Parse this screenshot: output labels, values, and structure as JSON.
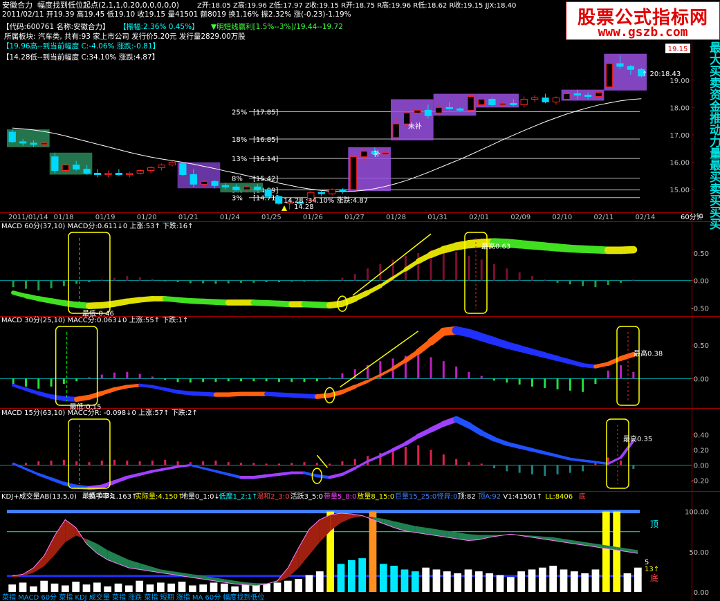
{
  "header": {
    "line1_name": "安徽合力",
    "line1_formula": "幅度找到低位起点(2,1,1,0,20,0,0,0,0,0)",
    "line1_stats": "Z开:18.05 Z高:19.96 Z低:17.97 Z收:19.15 R开:18.75 R高:19.96 R低:18.62 R收:19.15 JJX:18.40",
    "line2": "2011/02/11 开19.39 高19.45 低19.10 收19.15 量41501 额8019 换1.16% 振2.32% 涨(-0.23)-1.19%",
    "info_code": "【代码:600761 名称:安徽合力】",
    "info_amp": "【振幅:2.36% 0.45%】",
    "info_profit": "▼明短线赢利[1.5%--3%]/19.44--19.72",
    "info_sector": "所属板块: 汽车类, 共有:93 家上市公司  发行价5.20元  发行量2829.00万股",
    "info_high": "【19.96高--到当前幅度 C:-4.06%  涨跌:-0.81】",
    "info_low": "【14.28低--到当前幅度 C:34.10%  涨跌:4.87】"
  },
  "brand": {
    "title": "股票公式指标网",
    "url": "www.gszb.com"
  },
  "side_text": "最大买卖资金推动力量最买卖买买买",
  "dates": [
    "2011/01/14",
    "01/18",
    "01/19",
    "01/20",
    "01/21",
    "01/24",
    "01/25",
    "01/26",
    "01/27",
    "01/28",
    "01/31",
    "02/01",
    "02/09",
    "02/10",
    "02/11",
    "02/14"
  ],
  "period_label": "60分钟",
  "colors": {
    "up": "#ff2020",
    "down": "#00d8ff",
    "ma": "#ffffff",
    "grid": "#a00000",
    "level": "#c0c0c0"
  },
  "chart_data": [
    {
      "type": "candlestick",
      "name_label": "price",
      "y_ticks": [
        "19.00",
        "18.00",
        "17.00",
        "16.00",
        "15.00"
      ],
      "y_values": [
        19.0,
        18.0,
        17.0,
        16.0,
        15.0
      ],
      "ylim": [
        14.35,
        19.6
      ],
      "levels": [
        {
          "label": "25%",
          "price_label": "[17.85]",
          "value": 17.85
        },
        {
          "label": "18%",
          "price_label": "[16.85]",
          "value": 16.85
        },
        {
          "label": "13%",
          "price_label": "[16.14]",
          "value": 16.14
        },
        {
          "label": "8%",
          "price_label": "[15.42]",
          "value": 15.42
        },
        {
          "label": "5%",
          "price_label": "[14.99]",
          "value": 14.99
        },
        {
          "label": "3%",
          "price_label": "[14.71]",
          "value": 14.71
        }
      ],
      "ohlc": [
        [
          17.1,
          17.2,
          16.7,
          16.75
        ],
        [
          16.75,
          16.85,
          16.6,
          16.7
        ],
        [
          16.7,
          16.8,
          16.55,
          16.65
        ],
        [
          16.65,
          16.75,
          16.55,
          16.7
        ],
        [
          16.2,
          16.35,
          15.6,
          15.7
        ],
        [
          15.7,
          16.0,
          15.55,
          15.9
        ],
        [
          15.9,
          16.05,
          15.7,
          15.75
        ],
        [
          15.75,
          15.9,
          15.55,
          15.6
        ],
        [
          15.6,
          15.75,
          15.45,
          15.55
        ],
        [
          15.55,
          15.7,
          15.45,
          15.6
        ],
        [
          15.6,
          15.75,
          15.5,
          15.55
        ],
        [
          15.55,
          15.65,
          15.45,
          15.6
        ],
        [
          15.6,
          15.75,
          15.55,
          15.7
        ],
        [
          15.7,
          15.85,
          15.6,
          15.8
        ],
        [
          15.8,
          15.95,
          15.7,
          15.9
        ],
        [
          15.9,
          16.05,
          15.85,
          16.0
        ],
        [
          15.95,
          16.0,
          15.5,
          15.55
        ],
        [
          15.55,
          15.75,
          15.1,
          15.2
        ],
        [
          15.2,
          15.35,
          15.1,
          15.3
        ],
        [
          15.3,
          15.35,
          15.05,
          15.15
        ],
        [
          15.15,
          15.25,
          15.0,
          15.1
        ],
        [
          15.1,
          15.2,
          14.95,
          15.0
        ],
        [
          15.0,
          15.15,
          14.9,
          15.1
        ],
        [
          15.1,
          15.2,
          14.95,
          15.0
        ],
        [
          15.0,
          15.05,
          14.7,
          14.75
        ],
        [
          14.75,
          14.8,
          14.45,
          14.5
        ],
        [
          14.5,
          14.65,
          14.28,
          14.55
        ],
        [
          14.55,
          14.65,
          14.4,
          14.5
        ],
        [
          14.6,
          14.95,
          14.55,
          14.9
        ],
        [
          14.9,
          15.0,
          14.75,
          14.85
        ],
        [
          14.85,
          15.05,
          14.8,
          15.0
        ],
        [
          15.0,
          15.05,
          14.85,
          14.95
        ],
        [
          15.0,
          16.3,
          14.95,
          16.2
        ],
        [
          16.2,
          16.5,
          16.05,
          16.4
        ],
        [
          16.4,
          16.55,
          16.2,
          16.3
        ],
        [
          16.3,
          16.45,
          16.15,
          16.35
        ],
        [
          16.9,
          17.6,
          16.8,
          17.4
        ],
        [
          17.4,
          17.85,
          17.3,
          17.8
        ],
        [
          17.8,
          18.3,
          17.6,
          17.9
        ],
        [
          17.9,
          18.1,
          17.6,
          17.7
        ],
        [
          17.8,
          18.1,
          17.7,
          18.0
        ],
        [
          18.0,
          18.2,
          17.9,
          17.95
        ],
        [
          17.95,
          18.0,
          17.85,
          17.9
        ],
        [
          17.9,
          18.5,
          17.85,
          18.4
        ],
        [
          18.1,
          18.5,
          18.0,
          18.3
        ],
        [
          18.3,
          18.35,
          18.05,
          18.1
        ],
        [
          18.1,
          18.2,
          18.0,
          18.15
        ],
        [
          18.15,
          18.3,
          18.05,
          18.1
        ],
        [
          18.1,
          18.4,
          18.0,
          18.3
        ],
        [
          18.3,
          18.45,
          18.2,
          18.35
        ],
        [
          18.35,
          18.5,
          18.15,
          18.2
        ],
        [
          18.2,
          18.4,
          18.1,
          18.35
        ],
        [
          18.3,
          18.6,
          18.25,
          18.5
        ],
        [
          18.5,
          18.65,
          18.3,
          18.45
        ],
        [
          18.45,
          18.55,
          18.3,
          18.4
        ],
        [
          18.4,
          18.6,
          18.35,
          18.55
        ],
        [
          18.75,
          19.96,
          18.62,
          19.6
        ],
        [
          19.6,
          19.9,
          19.4,
          19.5
        ],
        [
          19.5,
          19.55,
          19.2,
          19.39
        ],
        [
          19.39,
          19.45,
          19.1,
          19.15
        ]
      ],
      "ma": [
        17.25,
        17.22,
        17.18,
        17.12,
        17.05,
        16.96,
        16.86,
        16.76,
        16.66,
        16.56,
        16.46,
        16.36,
        16.27,
        16.19,
        16.12,
        16.06,
        16.0,
        15.93,
        15.85,
        15.77,
        15.68,
        15.6,
        15.51,
        15.42,
        15.33,
        15.24,
        15.16,
        15.08,
        15.02,
        14.97,
        14.94,
        14.93,
        14.94,
        14.98,
        15.04,
        15.12,
        15.22,
        15.34,
        15.48,
        15.63,
        15.79,
        15.95,
        16.11,
        16.28,
        16.46,
        16.64,
        16.82,
        16.99,
        17.16,
        17.32,
        17.48,
        17.62,
        17.76,
        17.88,
        17.99,
        18.09,
        18.17,
        18.24,
        18.29,
        18.32
      ],
      "annotations": {
        "price_now": "19.15",
        "ma_value": "↑ 20:18.43",
        "low_label": "14.28",
        "low_stats": "14.28 :34.10%  涨跌:4.87",
        "high_label": "19.96",
        "supplement": "补",
        "supplement2": "未补",
        "supplement3": "补"
      }
    },
    {
      "type": "macd",
      "title": "MACD 60分(37,10)  MACD分:0.611↓0  上涨:53↑ 下跌:16↑",
      "y_ticks": [
        "0.50",
        "0.00",
        "-0.50"
      ],
      "y_values": [
        0.5,
        0.0,
        -0.5
      ],
      "ylim": [
        -0.62,
        0.9
      ],
      "values": [
        -0.22,
        -0.28,
        -0.33,
        -0.37,
        -0.41,
        -0.44,
        -0.46,
        -0.45,
        -0.42,
        -0.38,
        -0.35,
        -0.33,
        -0.33,
        -0.35,
        -0.37,
        -0.38,
        -0.39,
        -0.4,
        -0.4,
        -0.4,
        -0.41,
        -0.42,
        -0.43,
        -0.43,
        -0.44,
        -0.45,
        -0.42,
        -0.33,
        -0.22,
        -0.1,
        0.05,
        0.2,
        0.35,
        0.47,
        0.56,
        0.62,
        0.66,
        0.68,
        0.69,
        0.68,
        0.66,
        0.64,
        0.62,
        0.6,
        0.58,
        0.57,
        0.56,
        0.55,
        0.55,
        0.56
      ],
      "hist": [
        -0.12,
        -0.15,
        -0.18,
        -0.14,
        -0.1,
        -0.06,
        -0.03,
        0.02,
        0.05,
        0.08,
        0.06,
        0.03,
        -0.01,
        -0.03,
        -0.05,
        -0.05,
        -0.06,
        -0.05,
        -0.04,
        -0.04,
        -0.03,
        -0.03,
        -0.02,
        -0.02,
        -0.01,
        0.0,
        0.05,
        0.12,
        0.22,
        0.3,
        0.38,
        0.45,
        0.5,
        0.55,
        0.58,
        0.52,
        0.45,
        0.38,
        0.3,
        0.22,
        0.15,
        0.08,
        0.02,
        -0.04,
        -0.07,
        -0.1,
        -0.12,
        -0.08,
        -0.04,
        0.02
      ],
      "mark_low": "最低-0.46",
      "mark_high": "最高0.63"
    },
    {
      "type": "macd",
      "title": "MACD 30分(25,10)  MACC分:0.063↓0  上涨:55↑ 下跌:1↑",
      "y_ticks": [
        "0.50",
        "0.00"
      ],
      "y_values": [
        0.5,
        0.0
      ],
      "ylim": [
        -0.42,
        0.8
      ],
      "values": [
        -0.1,
        -0.16,
        -0.22,
        -0.27,
        -0.3,
        -0.31,
        -0.28,
        -0.22,
        -0.16,
        -0.12,
        -0.1,
        -0.12,
        -0.16,
        -0.2,
        -0.22,
        -0.23,
        -0.24,
        -0.24,
        -0.23,
        -0.23,
        -0.23,
        -0.24,
        -0.25,
        -0.26,
        -0.27,
        -0.25,
        -0.2,
        -0.12,
        -0.04,
        0.05,
        0.15,
        0.27,
        0.4,
        0.55,
        0.7,
        0.72,
        0.68,
        0.62,
        0.56,
        0.5,
        0.45,
        0.4,
        0.35,
        0.3,
        0.25,
        0.2,
        0.18,
        0.22,
        0.3,
        0.36
      ],
      "hist": [
        -0.1,
        -0.12,
        -0.15,
        -0.12,
        -0.08,
        -0.04,
        0.02,
        0.06,
        0.09,
        0.1,
        0.07,
        0.03,
        -0.02,
        -0.05,
        -0.06,
        -0.05,
        -0.05,
        -0.04,
        -0.04,
        -0.04,
        -0.04,
        -0.05,
        -0.05,
        -0.05,
        -0.04,
        0.02,
        0.08,
        0.14,
        0.2,
        0.26,
        0.3,
        0.34,
        0.36,
        0.32,
        0.26,
        0.18,
        0.1,
        0.04,
        -0.03,
        -0.06,
        -0.09,
        -0.12,
        -0.14,
        -0.16,
        -0.18,
        -0.2,
        -0.08,
        0.12,
        0.2,
        0.1
      ],
      "mark_low": "最低-0.15",
      "mark_high": "最高0.38"
    },
    {
      "type": "macd",
      "title": "MACD 15分(63,10)  MACC分R: -0.098↓0  上涨:57↑ 下跌:2↑",
      "y_ticks": [
        "0.40",
        "0.20",
        "0.00",
        "-0.20"
      ],
      "y_values": [
        0.4,
        0.2,
        0.0,
        -0.2
      ],
      "ylim": [
        -0.32,
        0.62
      ],
      "values": [
        0.02,
        -0.05,
        -0.12,
        -0.18,
        -0.24,
        -0.28,
        -0.3,
        -0.28,
        -0.22,
        -0.16,
        -0.12,
        -0.08,
        -0.05,
        -0.02,
        0.0,
        -0.04,
        -0.08,
        -0.12,
        -0.16,
        -0.16,
        -0.14,
        -0.12,
        -0.1,
        -0.1,
        -0.14,
        -0.16,
        -0.12,
        -0.04,
        0.05,
        0.12,
        0.2,
        0.28,
        0.38,
        0.46,
        0.54,
        0.6,
        0.52,
        0.42,
        0.34,
        0.28,
        0.24,
        0.2,
        0.16,
        0.12,
        0.08,
        0.06,
        0.04,
        0.02,
        0.1,
        0.32
      ],
      "hist": [
        0.02,
        0.03,
        0.05,
        0.06,
        0.07,
        0.05,
        0.04,
        0.06,
        0.07,
        0.06,
        0.05,
        0.06,
        0.07,
        0.05,
        0.04,
        0.05,
        0.06,
        0.04,
        0.03,
        0.03,
        0.02,
        0.02,
        0.03,
        0.04,
        0.03,
        0.02,
        0.05,
        0.08,
        0.12,
        0.16,
        0.2,
        0.24,
        0.26,
        0.2,
        0.14,
        0.08,
        0.04,
        0.02,
        -0.04,
        -0.08,
        -0.1,
        -0.12,
        -0.14,
        -0.12,
        -0.1,
        -0.08,
        0.04,
        0.1,
        0.06,
        -0.05
      ],
      "mark_low": "最低-0.31",
      "mark_high": "最高0.35"
    },
    {
      "type": "kdj_volume",
      "title_left": "KDJ+成交量AB(13,5,0)",
      "title_items": [
        {
          "text": "换手率:1.163↑",
          "color": "#ffffff"
        },
        {
          "text": "实际量:4.150↑",
          "color": "#ffff00"
        },
        {
          "text": "地量0_1:0↓",
          "color": "#ffffff"
        },
        {
          "text": "低靡1_2:1↑",
          "color": "#00ffff"
        },
        {
          "text": "温和2_3:0",
          "color": "#ff4040"
        },
        {
          "text": "活跃3_5:0",
          "color": "#ffffff"
        },
        {
          "text": "带量5_8:0",
          "color": "#ff40ff"
        },
        {
          "text": "放量8_15:0",
          "color": "#ffff00"
        },
        {
          "text": "巨量15_25:0",
          "color": "#4080ff"
        },
        {
          "text": "怪异:0",
          "color": "#4080ff"
        },
        {
          "text": "顶:82",
          "color": "#ffffff"
        },
        {
          "text": "顶A:92",
          "color": "#4080ff"
        },
        {
          "text": "V1:41501↑",
          "color": "#ffffff"
        },
        {
          "text": "LL:8406",
          "color": "#ffff00"
        },
        {
          "text": "底",
          "color": "#ff4040"
        }
      ],
      "y_ticks": [
        "100.00",
        "50.00",
        "0.00"
      ],
      "y_values": [
        100,
        50,
        0
      ],
      "ylim": [
        0,
        110
      ],
      "vol": [
        8,
        10,
        6,
        12,
        9,
        7,
        11,
        8,
        10,
        6,
        9,
        7,
        12,
        8,
        10,
        9,
        11,
        7,
        8,
        10,
        9,
        6,
        8,
        7,
        9,
        10,
        12,
        14,
        18,
        22,
        26,
        30,
        34,
        36,
        34,
        30,
        28,
        24,
        22,
        26,
        24,
        22,
        20,
        24,
        22,
        20,
        18,
        16,
        22,
        24,
        26,
        28,
        24,
        22,
        20,
        24,
        22,
        18,
        20,
        26
      ],
      "vol_highlight": {
        "30": "#ffff00",
        "34": "#ff9020",
        "56": "#ffff00",
        "57": "#ffff00"
      },
      "k": [
        20,
        22,
        30,
        45,
        70,
        90,
        80,
        60,
        48,
        40,
        35,
        30,
        28,
        26,
        24,
        22,
        20,
        18,
        16,
        14,
        12,
        10,
        9,
        8,
        10,
        14,
        30,
        55,
        78,
        90,
        96,
        98,
        97,
        95,
        90,
        85,
        80,
        76,
        74,
        72,
        70,
        68,
        66,
        64,
        65,
        68,
        70,
        72,
        70,
        68,
        66,
        64,
        62,
        60,
        58,
        56,
        54,
        52,
        50,
        48
      ],
      "d": [
        18,
        20,
        24,
        32,
        46,
        62,
        70,
        66,
        60,
        52,
        46,
        40,
        36,
        32,
        28,
        26,
        24,
        22,
        20,
        18,
        16,
        14,
        12,
        11,
        11,
        12,
        18,
        30,
        46,
        62,
        76,
        86,
        92,
        94,
        93,
        91,
        88,
        85,
        82,
        80,
        78,
        76,
        74,
        72,
        71,
        71,
        71,
        71,
        71,
        70,
        69,
        68,
        66,
        64,
        62,
        60,
        58,
        56,
        54,
        52
      ],
      "top_label": "顶",
      "bottom_label": "底",
      "right_values": [
        "5",
        "13↑"
      ]
    }
  ],
  "footer": "菜指   MACD 60分 菜指 KDJ 成交量 菜指 涨跌 菜指 短期 涨指 MA 60分 幅度找到低位"
}
